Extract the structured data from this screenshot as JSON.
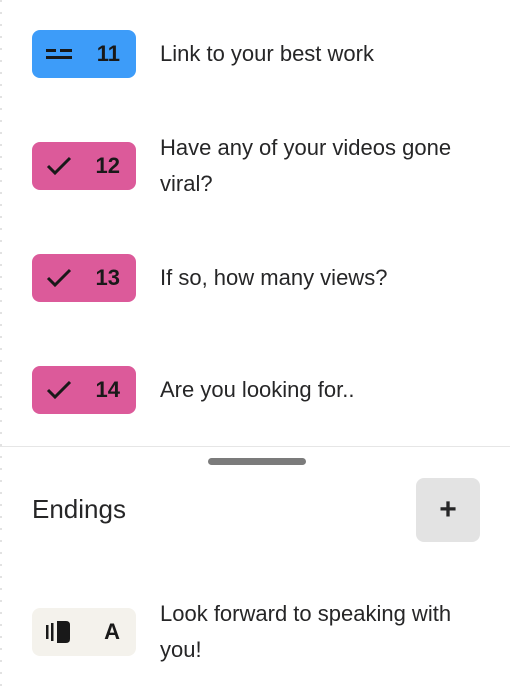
{
  "questions": [
    {
      "number": "11",
      "label": "Link to your best work",
      "type_icon": "short-text-icon",
      "color": "#3d9cf9"
    },
    {
      "number": "12",
      "label": "Have any of your videos gone viral?",
      "type_icon": "check-icon",
      "color": "#dc5a9a"
    },
    {
      "number": "13",
      "label": "If so, how many views?",
      "type_icon": "check-icon",
      "color": "#dc5a9a"
    },
    {
      "number": "14",
      "label": "Are you looking for..",
      "type_icon": "check-icon",
      "color": "#dc5a9a"
    }
  ],
  "endings": {
    "title": "Endings",
    "add_button_label": "+",
    "items": [
      {
        "letter": "A",
        "label": "Look forward to speaking with you!",
        "type_icon": "ending-screen-icon",
        "color": "#f4f2ec"
      }
    ]
  }
}
